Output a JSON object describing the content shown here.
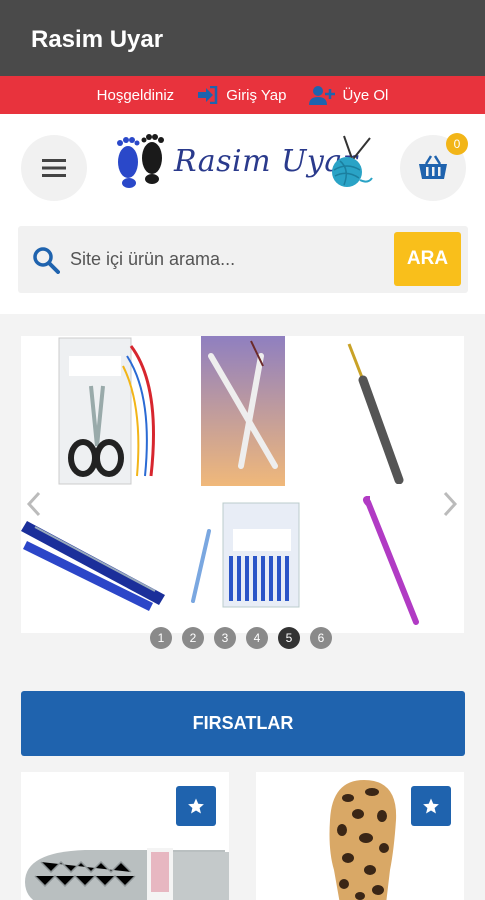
{
  "appbar": {
    "title": "Rasim Uyar"
  },
  "topbar": {
    "welcome": "Hoşgeldiniz",
    "login": "Giriş Yap",
    "register": "Üye Ol"
  },
  "logo": {
    "text": "Rasim Uyar"
  },
  "cart": {
    "count": "0"
  },
  "search": {
    "placeholder": "Site içi ürün arama...",
    "button": "ARA"
  },
  "slider": {
    "pages": [
      "1",
      "2",
      "3",
      "4",
      "5",
      "6"
    ],
    "active_page": "5"
  },
  "deals": {
    "label": "FIRSATLAR"
  },
  "colors": {
    "appbar": "#4a4a4a",
    "topbar": "#e8333d",
    "primary": "#1f63ae",
    "accent": "#f9bf1b"
  }
}
